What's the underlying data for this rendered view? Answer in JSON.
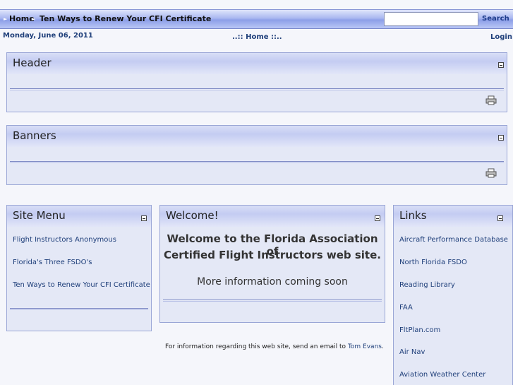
{
  "topbar": {
    "breadcrumb_home": "Home",
    "breadcrumb_current": "Ten Ways to Renew Your CFI Certificate",
    "search_value": "",
    "search_button": "Search"
  },
  "info_row": {
    "date": "Monday, June 06, 2011",
    "home_link": "..:: Home ::..",
    "login": "Login"
  },
  "header_panel": {
    "title": "Header"
  },
  "banners_panel": {
    "title": "Banners"
  },
  "site_menu": {
    "title": "Site Menu",
    "items": [
      "Flight Instructors Anonymous",
      "Florida's Three FSDO's",
      "Ten Ways to Renew Your CFI Certificate"
    ]
  },
  "welcome": {
    "title": "Welcome!",
    "line1": "Welcome to the Florida Association of",
    "line2": "Certified Flight Instructors web site.",
    "more": "More information coming soon"
  },
  "footer": {
    "text": "For information regarding this web site, send an email to",
    "link": "Tom Evans",
    "end": "."
  },
  "links": {
    "title": "Links",
    "items": [
      "Aircraft Performance Database",
      "North Florida FSDO",
      "Reading Library",
      "FAA",
      "FltPlan.com",
      "Air Nav",
      "Aviation Weather Center"
    ]
  },
  "icons": {
    "print": "printer-icon",
    "collapse": "minimize-icon",
    "breadcrumb_arrow": "arrow-right-icon"
  },
  "colors": {
    "accent": "#8d9fe8",
    "link": "#1f3f7a",
    "panel_bg": "#e4e8f6"
  }
}
